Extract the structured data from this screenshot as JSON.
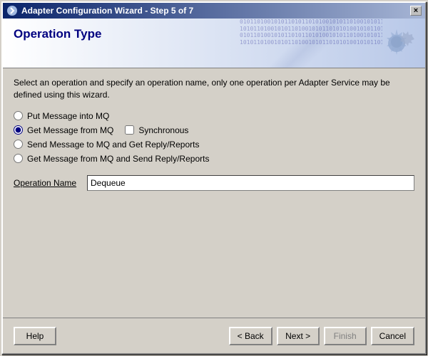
{
  "window": {
    "title": "Adapter Configuration Wizard - Step 5 of 7",
    "close_btn": "×"
  },
  "header": {
    "title": "Operation Type"
  },
  "description": "Select an operation and specify an operation name, only one operation per Adapter Service may be defined using this wizard.",
  "radio_options": [
    {
      "id": "opt1",
      "label": "Put Message into MQ",
      "checked": false
    },
    {
      "id": "opt2",
      "label": "Get Message from MQ",
      "checked": true
    },
    {
      "id": "opt3",
      "label": "Send Message to MQ and Get Reply/Reports",
      "checked": false
    },
    {
      "id": "opt4",
      "label": "Get Message from MQ and Send Reply/Reports",
      "checked": false
    }
  ],
  "synchronous": {
    "label": "Synchronous",
    "checked": false
  },
  "operation_name": {
    "label": "Operation Name",
    "value": "Dequeue"
  },
  "footer": {
    "help_label": "Help",
    "back_label": "< Back",
    "next_label": "Next >",
    "finish_label": "Finish",
    "cancel_label": "Cancel"
  }
}
